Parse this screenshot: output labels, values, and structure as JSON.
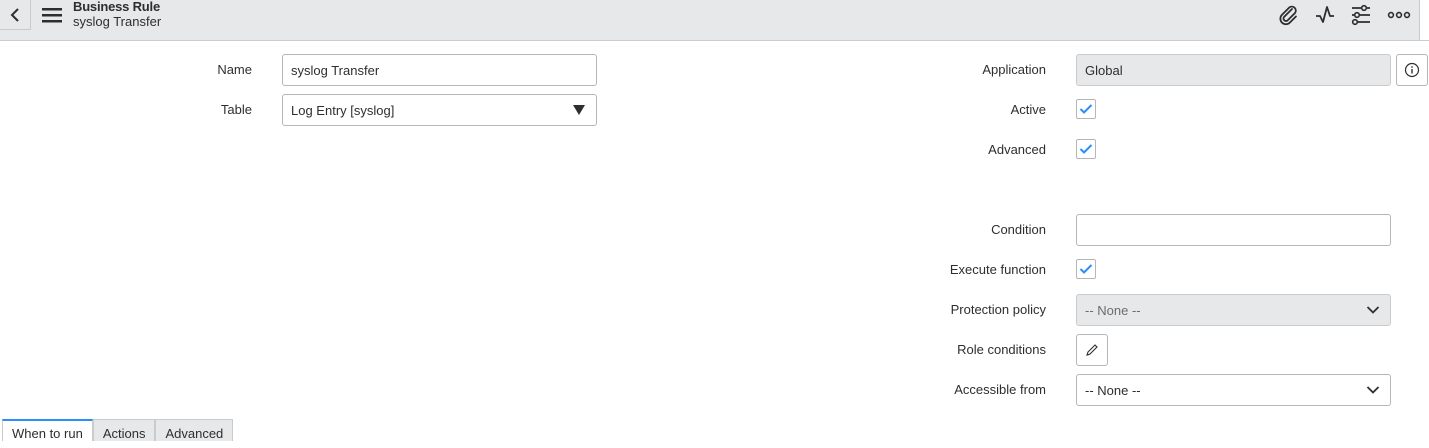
{
  "header": {
    "record_type": "Business Rule",
    "record_name": "syslog Transfer",
    "icons": [
      "chevron-left-icon",
      "hamburger-menu-icon",
      "paperclip-icon",
      "activity-icon",
      "sliders-icon",
      "more-icon"
    ]
  },
  "form": {
    "name": {
      "label": "Name",
      "value": "syslog Transfer"
    },
    "table": {
      "label": "Table",
      "value": "Log Entry [syslog]"
    },
    "application": {
      "label": "Application",
      "value": "Global"
    },
    "active": {
      "label": "Active",
      "checked": true
    },
    "advanced": {
      "label": "Advanced",
      "checked": true
    },
    "condition": {
      "label": "Condition",
      "value": ""
    },
    "execute_function": {
      "label": "Execute function",
      "checked": true
    },
    "protection_policy": {
      "label": "Protection policy",
      "value": "-- None --"
    },
    "role_conditions": {
      "label": "Role conditions"
    },
    "accessible_from": {
      "label": "Accessible from",
      "value": "-- None --"
    }
  },
  "tabs": [
    {
      "label": "When to run",
      "active": true
    },
    {
      "label": "Actions",
      "active": false
    },
    {
      "label": "Advanced",
      "active": false
    }
  ],
  "colors": {
    "accent": "#278efc",
    "header_bg": "#e6e8ea",
    "check": "#278efc"
  }
}
